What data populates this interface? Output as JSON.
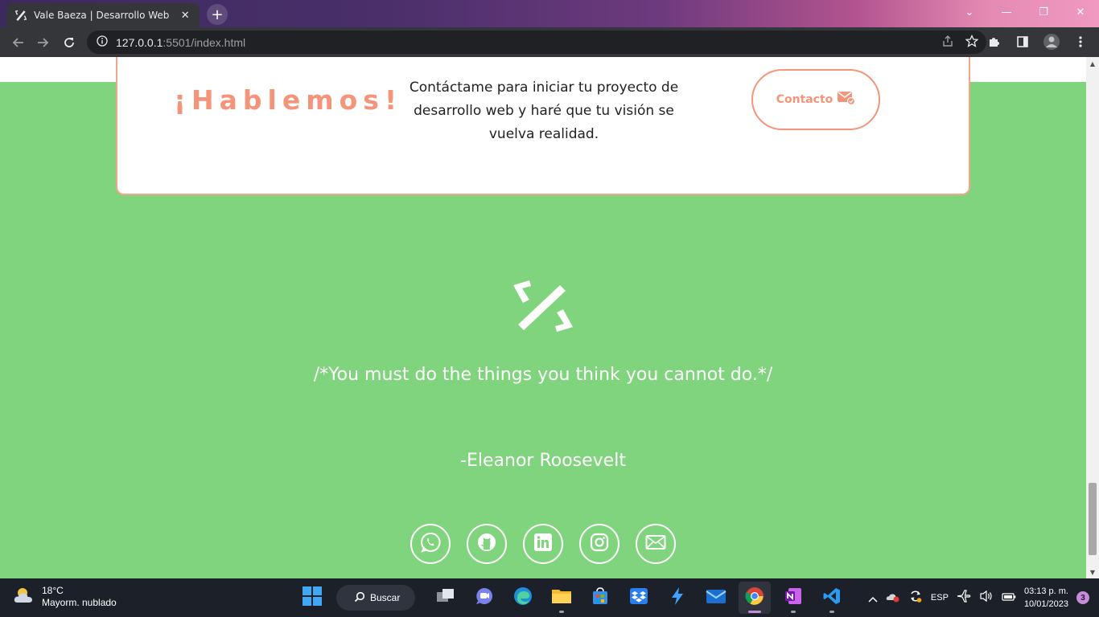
{
  "browser": {
    "tab_title": "Vale Baeza | Desarrollo Web Fron",
    "tab_close": "✕",
    "new_tab": "+",
    "url_host": "127.0.0.1",
    "url_rest": ":5501/index.html",
    "window_controls": {
      "minimize": "—",
      "restore": "❐",
      "close": "✕",
      "tab_search": "⌄"
    }
  },
  "page": {
    "cta": {
      "title": "¡Hablemos!",
      "text": "Contáctame para iniciar tu proyecto de desarrollo web y haré que tu visión se vuelva realidad.",
      "button_label": "Contacto"
    },
    "quote": "/*You must do the things you think you cannot do.*/",
    "author": "-Eleanor Roosevelt",
    "socials": [
      "whatsapp-icon",
      "github-icon",
      "linkedin-icon",
      "instagram-icon",
      "mail-icon"
    ],
    "colors": {
      "background": "#80d47d",
      "accent": "#f4947a"
    }
  },
  "taskbar": {
    "weather_temp": "18°C",
    "weather_desc": "Mayorm. nublado",
    "search_label": "Buscar",
    "lang": "ESP",
    "time": "03:13 p. m.",
    "date": "10/01/2023",
    "notifications": "3"
  }
}
